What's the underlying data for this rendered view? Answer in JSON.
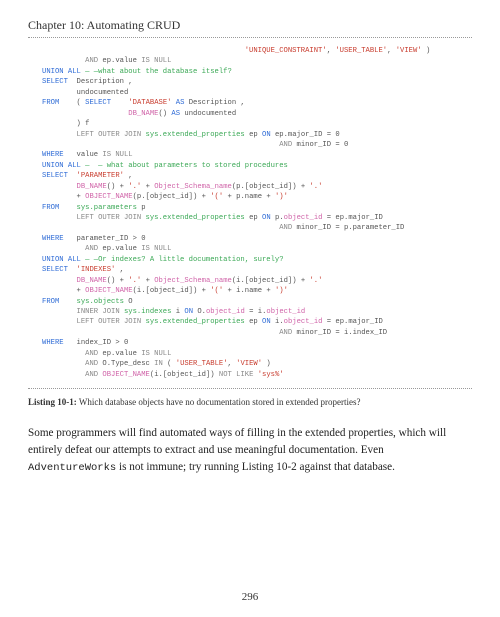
{
  "chapter": "Chapter 10: Automating CRUD",
  "code": {
    "l1a": "                                               ",
    "l1b": "'UNIQUE_CONSTRAINT'",
    "l1c": ", ",
    "l1d": "'USER_TABLE'",
    "l1e": ", ",
    "l1f": "'VIEW'",
    "l1g": " )",
    "l2a": "          ",
    "l2b": "AND",
    "l2c": " ep.value ",
    "l2d": "IS NULL",
    "l3a": "UNION ALL",
    "l3b": " — —what about the database itself?",
    "l4a": "SELECT",
    "l4b": "  Description ,",
    "l5": "        undocumented",
    "l6a": "FROM",
    "l6b": "    ( ",
    "l6c": "SELECT",
    "l6d": "    ",
    "l6e": "'DATABASE'",
    "l6f": " ",
    "l6g": "AS",
    "l6h": " Description ,",
    "l7a": "                    ",
    "l7b": "DB_NAME",
    "l7c": "() ",
    "l7d": "AS",
    "l7e": " undocumented",
    "l8": "        ) f",
    "l9a": "        ",
    "l9b": "LEFT OUTER JOIN",
    "l9c": " ",
    "l9d": "sys.extended_properties",
    "l9e": " ep ",
    "l9f": "ON",
    "l9g": " ep.major_ID = 0",
    "l10a": "                                                       ",
    "l10b": "AND",
    "l10c": " minor_ID = 0",
    "l11a": "WHERE",
    "l11b": "   value ",
    "l11c": "IS NULL",
    "l12a": "UNION ALL",
    "l12b": " —  — what about parameters to stored procedures",
    "l13a": "SELECT",
    "l13b": "  ",
    "l13c": "'PARAMETER'",
    "l13d": " ,",
    "l14a": "        ",
    "l14b": "DB_NAME",
    "l14c": "() + ",
    "l14d": "'.'",
    "l14e": " + ",
    "l14f": "Object_Schema_name",
    "l14g": "(p.[object_id]) + ",
    "l14h": "'.'",
    "l15a": "        + ",
    "l15b": "OBJECT_NAME",
    "l15c": "(p.[object_id]) + ",
    "l15d": "'('",
    "l15e": " + p.name + ",
    "l15f": "')'",
    "l16a": "FROM",
    "l16b": "    ",
    "l16c": "sys.parameters",
    "l16d": " p",
    "l17a": "        ",
    "l17b": "LEFT OUTER JOIN",
    "l17c": " ",
    "l17d": "sys.extended_properties",
    "l17e": " ep ",
    "l17f": "ON",
    "l17g": " p.",
    "l17h": "object_id",
    "l17i": " = ep.major_ID",
    "l18a": "                                                       ",
    "l18b": "AND",
    "l18c": " minor_ID = p.parameter_ID",
    "l19a": "WHERE",
    "l19b": "   parameter_ID > 0",
    "l20a": "          ",
    "l20b": "AND",
    "l20c": " ep.value ",
    "l20d": "IS NULL",
    "l21a": "UNION ALL",
    "l21b": " — —Or indexes? A little documentation, surely?",
    "l22a": "SELECT",
    "l22b": "  ",
    "l22c": "'INDEXES'",
    "l22d": " ,",
    "l23a": "        ",
    "l23b": "DB_NAME",
    "l23c": "() + ",
    "l23d": "'.'",
    "l23e": " + ",
    "l23f": "Object_Schema_name",
    "l23g": "(i.[object_id]) + ",
    "l23h": "'.'",
    "l24a": "        + ",
    "l24b": "OBJECT_NAME",
    "l24c": "(i.[object_id]) + ",
    "l24d": "'('",
    "l24e": " + i.name + ",
    "l24f": "')'",
    "l25a": "FROM",
    "l25b": "    ",
    "l25c": "sys.objects",
    "l25d": " O",
    "l26a": "        ",
    "l26b": "INNER JOIN",
    "l26c": " ",
    "l26d": "sys.indexes",
    "l26e": " i ",
    "l26f": "ON",
    "l26g": " O.",
    "l26h": "object_id",
    "l26i": " = i.",
    "l26j": "object_id",
    "l27a": "        ",
    "l27b": "LEFT OUTER JOIN",
    "l27c": " ",
    "l27d": "sys.extended_properties",
    "l27e": " ep ",
    "l27f": "ON",
    "l27g": " i.",
    "l27h": "object_id",
    "l27i": " = ep.major_ID",
    "l28a": "                                                       ",
    "l28b": "AND",
    "l28c": " minor_ID = i.index_ID",
    "l29a": "WHERE",
    "l29b": "   index_ID > 0",
    "l30a": "          ",
    "l30b": "AND",
    "l30c": " ep.value ",
    "l30d": "IS NULL",
    "l31a": "          ",
    "l31b": "AND",
    "l31c": " O.Type_desc ",
    "l31d": "IN",
    "l31e": " ( ",
    "l31f": "'USER_TABLE'",
    "l31g": ", ",
    "l31h": "'VIEW'",
    "l31i": " )",
    "l32a": "          ",
    "l32b": "AND",
    "l32c": " ",
    "l32d": "OBJECT_NAME",
    "l32e": "(i.[object_id]) ",
    "l32f": "NOT LIKE",
    "l32g": " ",
    "l32h": "'sys%'"
  },
  "caption_label": "Listing 10-1:",
  "caption_text": "  Which database objects have no documentation stored in extended properties?",
  "body1": "Some programmers will find automated ways of filling in the extended properties, which will entirely defeat our attempts to extract and use meaningful documentation. Even ",
  "body_mono": "AdventureWorks",
  "body2": " is not immune; try running Listing 10-2 against that database.",
  "page_number": "296"
}
